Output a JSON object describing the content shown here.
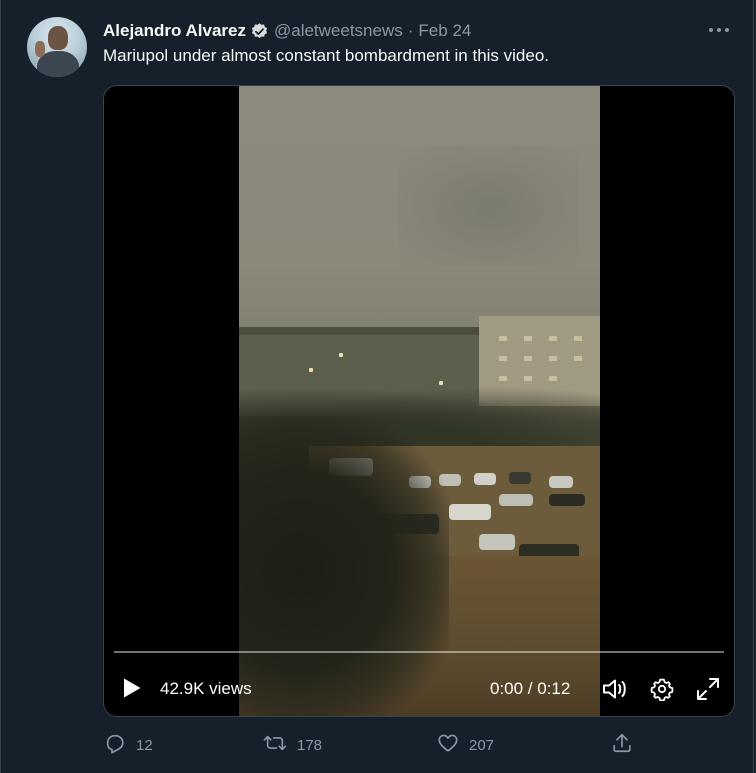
{
  "author": {
    "name": "Alejandro Alvarez",
    "handle": "@aletweetsnews",
    "separator": "·",
    "date": "Feb 24",
    "verified": true
  },
  "tweet": {
    "text": "Mariupol under almost constant bombardment in this video."
  },
  "video": {
    "views": "42.9K views",
    "time": "0:00 / 0:12",
    "progress_fraction": 0.0,
    "state": "paused"
  },
  "actions": {
    "reply_count": "12",
    "retweet_count": "178",
    "like_count": "207"
  },
  "icons": {
    "more": "more-icon",
    "verified": "verified-badge-icon",
    "play": "play-icon",
    "volume": "volume-icon",
    "settings": "settings-gear-icon",
    "fullscreen": "fullscreen-icon",
    "reply": "reply-icon",
    "retweet": "retweet-icon",
    "like": "like-icon",
    "share": "share-icon"
  },
  "colors": {
    "background": "#15202b",
    "text": "#f7f9f9",
    "secondary": "#8b98a5",
    "accent": "#1d9bf0"
  }
}
